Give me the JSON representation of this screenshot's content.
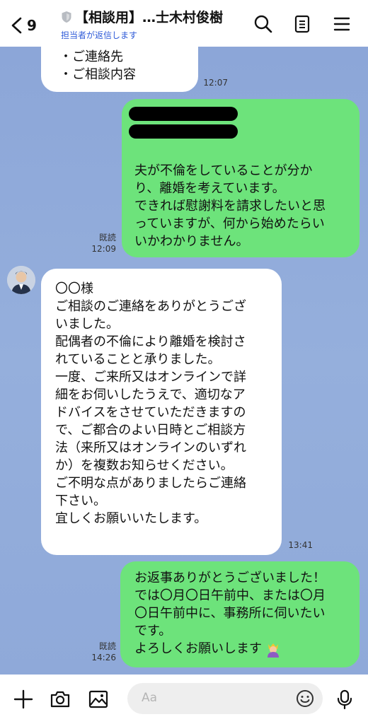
{
  "header": {
    "back_count": "9",
    "title": "【相談用】…士木村俊樹",
    "subtitle": "担当者が返信します"
  },
  "messages": {
    "m1": {
      "lines": [
        "・ご連絡先",
        "・ご相談内容"
      ],
      "time": "12:07"
    },
    "m2": {
      "lines": [
        "夫が不倫をしていることが分か",
        "り、離婚を考えています。",
        "できれば慰謝料を請求したいと思",
        "っていますが、何から始めたらい",
        "いかわかりません。"
      ],
      "read": "既読",
      "time": "12:09"
    },
    "m3": {
      "lines": [
        "〇〇様",
        "ご相談のご連絡をありがとうござ",
        "いました。",
        "配偶者の不倫により離婚を検討さ",
        "れていることと承りました。",
        "一度、ご来所又はオンラインで詳",
        "細をお伺いしたうえで、適切なア",
        "ドバイスをさせていただきますの",
        "で、ご都合のよい日時とご相談方",
        "法（来所又はオンラインのいずれ",
        "か）を複数お知らせください。",
        "ご不明な点がありましたらご連絡",
        "下さい。",
        "宜しくお願いいたします。"
      ],
      "time": "13:41"
    },
    "m4": {
      "lines": [
        "お返事ありがとうございました！",
        "では〇月〇日午前中、または〇月",
        "〇日午前中に、事務所に伺いたい",
        "です。",
        "よろしくお願いします"
      ],
      "read": "既読",
      "time": "14:26"
    }
  },
  "composer": {
    "placeholder": "Aa"
  },
  "icons": [
    "chevron-left-icon",
    "shield-icon",
    "search-icon",
    "notes-icon",
    "menu-icon",
    "plus-icon",
    "camera-icon",
    "image-icon",
    "emoji-icon",
    "mic-icon"
  ]
}
